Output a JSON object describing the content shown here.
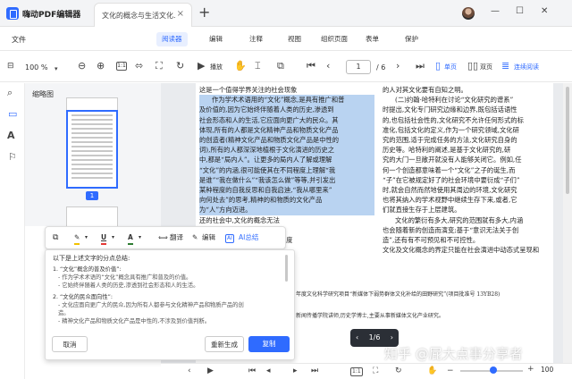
{
  "app": {
    "name": "嗨动PDF编辑器",
    "tab_title": "文化的概念与生活文化...",
    "tab_close": "×",
    "new_tab": "+",
    "win_min": "—",
    "win_max": "☐",
    "win_close": "✕"
  },
  "menubar": {
    "file": "文件",
    "tabs": [
      "阅读器",
      "编辑",
      "注释",
      "视图",
      "组织页面",
      "表单",
      "保护"
    ],
    "active": "阅读器"
  },
  "toolbar": {
    "zoom": "100 %",
    "play_label": "播放",
    "page_current": "1",
    "page_total": "/ 6",
    "view_single": "单页",
    "view_double": "双页",
    "view_continuous": "连续阅读",
    "fit_label": "1:1"
  },
  "thumbnails": {
    "title": "缩略图",
    "page_number": "1"
  },
  "document": {
    "left_column": [
      "这是一个值得学界关注的社会现象",
      "作为学术术语用的“文化”概念,是具有推广和普",
      "及价值的,因为它始终伴随着人类的历史,渗透到",
      "社会形态和人的生活,它应面向更广大的民众。其",
      "体现,所有的人都是文化精神产品和物质文化产品",
      "的创造者(精神文化产品和物质文化产品是中性的",
      "词),所有的人都深深地植根于文化演进的历史之",
      "中,都是“局内人”。让更多的局内人了解或理解",
      "“文化”的内涵,很可能使其在不同程度上理解“我",
      "是谁”“我在做什么”“我该怎么做”等等,并引发出",
      "某种程度的自我反思和自我启迪,“我从哪里来”",
      "向何处去”的思考,精神的和物质的文化产品",
      "为“人”方向迈进。",
      "",
      "还的社会中,文化的概念无法",
      "在上,但如果能正确解读,容易",
      "起到积极的作用,成为在不同程度",
      "上,生活态度和社"
    ],
    "left_highlight_from": 1,
    "left_highlight_to": 12,
    "right_column": [
      "的人对其文化要有自知之明。",
      "(二)约翰·哈特利在讨论“文化研究的谱系”",
      "时提出,文化专门研究边缘和边界,既包括话语性",
      "的,也包括社会性的,文化研究不允许任何形式的标",
      "准化,包括文化的定义,作为一个研究领域,文化研",
      "究的范围,适于完成任务的方法,文化研究自身的",
      "历史等。哈特利的阐述,是基于文化研究的,研",
      "究的大门一旦敞开就没有人能够关闭它。例如,任",
      "何一个创造都意味着一个“文化”之子的诞生,而",
      "“子”在它被规定好了的社会环境中要衍成“子们”",
      "时,就会自然而然地使用其周边的环境,文化研究",
      "也将其纳入的学术视野中继续生存下来,或者,它",
      "们就直接生存于上层建筑。",
      "",
      "文化的繁衍有多大,研究的范围就有多大,内涵",
      "也会随着新的创造而演变;基于“意识无法关于创",
      "造”,还有有不可预见和不可控性。",
      "文化及文化概念的界定只能在社会演进中动态式呈现和"
    ],
    "footnote_1": "年度文化科学研究项目“新媒体下弱势群体文化补给的田野研究”(项目批准号 13YB28)",
    "footnote_2": "新闻传播学院讲师,历史学博士,主要从事新媒体文化产业研究。"
  },
  "selection_toolbar": {
    "translate": "翻译",
    "edit": "编辑",
    "ai_summary": "AI总结"
  },
  "ai_panel": {
    "intro": "以下是上述文字的分点总结:",
    "item1_title": "1. “文化”概念的普及价值”:",
    "item1_bullets": [
      "- 作为学术术语的“文化”概念具有推广和普及的价值。",
      "- 它始终伴随着人类的历史,渗透到社会形态和人的生活。"
    ],
    "item2_title": "2. “文化的民众面向性”:",
    "item2_bullets": [
      "- 文化应面向更广大的民众,因为所有人都参与文化精神产品和物质产品的创",
      "造。",
      "- 精神文化产品和物质文化产品是中性的,不涉及到价值判断。"
    ],
    "cancel": "取消",
    "regenerate": "重新生成",
    "copy": "复制"
  },
  "page_pill": "1/6",
  "status": {
    "zoom_pct": "100",
    "fit": "1:1"
  },
  "watermark": "知乎 @屁大点事分享者"
}
